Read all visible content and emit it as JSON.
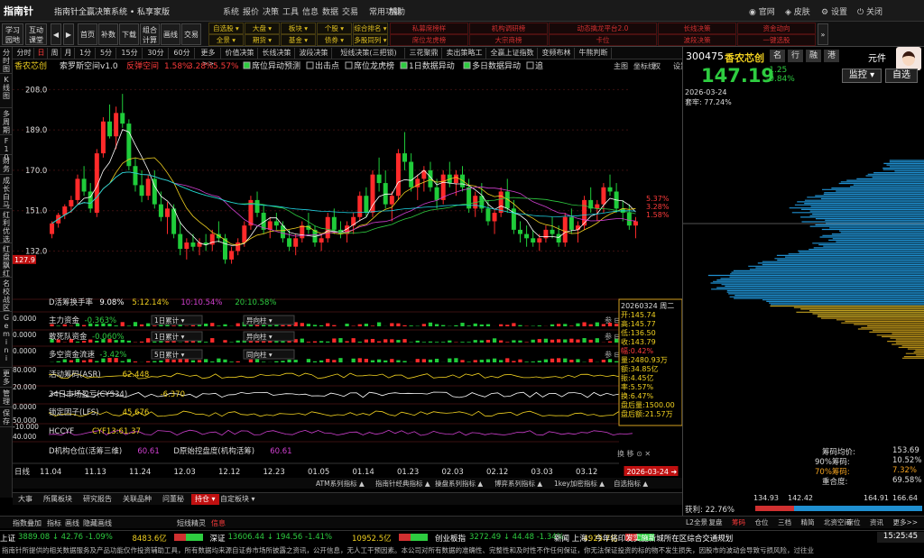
{
  "app": {
    "logo": "指南针",
    "title": "指南针全赢决策系统 • 私享家版",
    "menus": [
      "系统",
      "报价",
      "决策",
      "工具",
      "信息",
      "数据",
      "交易",
      "常用功能",
      "帮助"
    ],
    "win": [
      "官网",
      "皮肤",
      "设置",
      "关闭"
    ]
  },
  "toolbar": {
    "left": [
      {
        "a": "学习",
        "b": "园地"
      },
      {
        "a": "互动",
        "b": "课堂"
      }
    ],
    "nav": [
      "首页",
      "补数",
      "下载",
      "组合",
      "画线",
      "交易"
    ],
    "nav_sub": {
      "组合": "计算"
    },
    "grid_yellow": [
      [
        "自选股",
        "大盘",
        "板块",
        "个股",
        "综合排名"
      ],
      [
        "全景",
        "期货",
        "基金",
        "债券",
        "多股同列"
      ]
    ],
    "grid_red": [
      [
        "私募席榜样",
        "机构调研榜",
        "动态擒龙平台2.0",
        "长线决策",
        "资金动向"
      ],
      [
        "席位龙虎榜",
        "大宗商榜",
        "卡位",
        "波段决策",
        "一键选股"
      ]
    ]
  },
  "lefttabs": [
    "分时图",
    "K线图",
    "多周期",
    "F10",
    "财务",
    "成长白马",
    "红利优选",
    "红盘飘红",
    "名校战区",
    "Gemini",
    "更多",
    "管理",
    "保存"
  ],
  "periods": [
    "分时",
    "日",
    "周",
    "月",
    "1分",
    "5分",
    "15分",
    "30分",
    "60分",
    "更多>>"
  ],
  "strategies": [
    "价值决策",
    "长线决策",
    "波段决策",
    "短线决策(三把锁)",
    "三花聚鼎",
    "卖出策略工",
    "全赢上证指数",
    "变频布林",
    "牛熊判断"
  ],
  "stock": {
    "name": "香农芯创",
    "formula": "索罗斯空间v1.0",
    "extra": "反弹空间",
    "p1": "1.58%",
    "p2": "3.28%",
    "p3": "5.57%",
    "checks": [
      "席位异动预测",
      "出击点",
      "席位龙虎榜",
      "1日数据异动",
      "多日数据异动",
      "追"
    ],
    "tools": [
      "主图",
      "坐标线",
      "权",
      "设置"
    ]
  },
  "chart_data": {
    "type": "candlestick",
    "y_ticks": [
      208.0,
      189.0,
      170.0,
      151.0,
      132.0
    ],
    "current_price_label": "127.9",
    "x_ticks": [
      "11.04",
      "11.13",
      "11.24",
      "12.03",
      "12.12",
      "12.23",
      "01.05",
      "01.14",
      "01.23",
      "02.03",
      "02.12",
      "03.03",
      "03.12",
      "2026-03-24"
    ],
    "x_prefix": "日线",
    "right_labels": [
      "5.37%",
      "3.28%",
      "1.58%"
    ],
    "candles": [
      [
        140,
        146,
        138,
        145
      ],
      [
        145,
        150,
        143,
        149
      ],
      [
        149,
        154,
        147,
        153
      ],
      [
        153,
        158,
        150,
        156
      ],
      [
        156,
        168,
        154,
        166
      ],
      [
        166,
        172,
        158,
        160
      ],
      [
        160,
        164,
        150,
        152
      ],
      [
        150,
        180,
        148,
        178
      ],
      [
        178,
        195,
        176,
        193
      ],
      [
        193,
        201,
        185,
        186
      ],
      [
        186,
        200,
        180,
        197
      ],
      [
        197,
        206,
        190,
        192
      ],
      [
        192,
        194,
        170,
        172
      ],
      [
        172,
        176,
        160,
        163
      ],
      [
        163,
        170,
        155,
        158
      ],
      [
        158,
        168,
        156,
        166
      ],
      [
        166,
        170,
        152,
        154
      ],
      [
        154,
        160,
        146,
        148
      ],
      [
        148,
        155,
        140,
        152
      ],
      [
        152,
        154,
        138,
        140
      ],
      [
        140,
        146,
        130,
        133
      ],
      [
        133,
        138,
        128,
        136
      ],
      [
        136,
        140,
        132,
        134
      ],
      [
        134,
        138,
        130,
        136
      ],
      [
        136,
        140,
        132,
        135
      ],
      [
        135,
        142,
        132,
        140
      ],
      [
        140,
        146,
        136,
        138
      ],
      [
        138,
        140,
        126,
        128
      ],
      [
        128,
        134,
        126,
        132
      ],
      [
        132,
        138,
        130,
        136
      ],
      [
        136,
        146,
        134,
        144
      ],
      [
        144,
        158,
        142,
        156
      ],
      [
        156,
        160,
        148,
        150
      ],
      [
        150,
        154,
        140,
        142
      ],
      [
        142,
        148,
        138,
        146
      ],
      [
        146,
        150,
        142,
        144
      ],
      [
        144,
        146,
        136,
        138
      ],
      [
        138,
        142,
        132,
        134
      ],
      [
        134,
        140,
        130,
        138
      ],
      [
        138,
        146,
        136,
        144
      ],
      [
        144,
        150,
        140,
        142
      ],
      [
        142,
        144,
        134,
        136
      ],
      [
        136,
        140,
        132,
        138
      ],
      [
        138,
        150,
        136,
        148
      ],
      [
        148,
        152,
        140,
        142
      ],
      [
        142,
        146,
        138,
        140
      ],
      [
        140,
        146,
        136,
        144
      ],
      [
        144,
        150,
        140,
        148
      ],
      [
        148,
        160,
        146,
        158
      ],
      [
        158,
        162,
        148,
        150
      ],
      [
        150,
        170,
        148,
        168
      ],
      [
        168,
        176,
        160,
        164
      ],
      [
        164,
        170,
        152,
        154
      ],
      [
        154,
        160,
        146,
        158
      ],
      [
        158,
        180,
        156,
        178
      ],
      [
        178,
        188,
        170,
        174
      ],
      [
        174,
        178,
        160,
        162
      ],
      [
        162,
        168,
        156,
        166
      ],
      [
        166,
        172,
        160,
        170
      ],
      [
        170,
        174,
        160,
        162
      ],
      [
        162,
        166,
        152,
        156
      ],
      [
        156,
        170,
        154,
        168
      ],
      [
        168,
        174,
        162,
        164
      ],
      [
        164,
        170,
        158,
        168
      ],
      [
        168,
        172,
        160,
        162
      ],
      [
        162,
        166,
        150,
        152
      ],
      [
        152,
        160,
        148,
        158
      ],
      [
        158,
        164,
        150,
        152
      ],
      [
        152,
        156,
        144,
        146
      ],
      [
        146,
        152,
        140,
        150
      ],
      [
        150,
        162,
        148,
        160
      ],
      [
        160,
        166,
        150,
        152
      ],
      [
        152,
        156,
        140,
        142
      ],
      [
        142,
        146,
        136,
        140
      ],
      [
        140,
        144,
        134,
        138
      ],
      [
        138,
        142,
        134,
        136
      ],
      [
        136,
        140,
        132,
        138
      ],
      [
        138,
        144,
        136,
        142
      ],
      [
        142,
        148,
        138,
        140
      ],
      [
        140,
        144,
        134,
        136
      ],
      [
        136,
        150,
        134,
        148
      ],
      [
        148,
        152,
        140,
        142
      ],
      [
        142,
        146,
        136,
        144
      ],
      [
        144,
        158,
        142,
        156
      ],
      [
        156,
        162,
        150,
        152
      ],
      [
        152,
        156,
        146,
        154
      ],
      [
        154,
        164,
        150,
        162
      ],
      [
        162,
        168,
        158,
        160
      ],
      [
        160,
        164,
        150,
        152
      ],
      [
        152,
        156,
        146,
        150
      ],
      [
        150,
        154,
        142,
        144
      ],
      [
        144,
        148,
        138,
        146
      ]
    ]
  },
  "indicators": [
    {
      "name": "D活筹换手率",
      "vals": [
        "9.08%",
        "5:12.14%",
        "10:10.54%",
        "20:10.58%"
      ]
    },
    {
      "name": "主力资金",
      "val": "-0.363%",
      "sel": "1日累计",
      "sel2": "异向柱"
    },
    {
      "name": "敢死队资金",
      "val": "-0.060%",
      "sel": "1日累计",
      "sel2": "异向柱"
    },
    {
      "name": "多空资金流速",
      "val": "-3.42%",
      "sel": "5日累计",
      "sel2": "同向柱"
    },
    {
      "name": "活动筹码(ASR)",
      "val": "62.448"
    },
    {
      "name": "34日市场盈亏(CYS34)",
      "val": "-6.370"
    },
    {
      "name": "锁定因子(LFS)",
      "val": "45.676"
    },
    {
      "name": "HCCYF",
      "val": "CYF13:61.37"
    },
    {
      "name": "D机构仓位(活筹三维)",
      "val": "60.61",
      "name2": "D原始控盘度(机构活筹)",
      "val2": "60.61"
    }
  ],
  "ind_axis": {
    "a": "0.0000",
    "b": "0.0000",
    "c": "0.0000",
    "d": "80.000",
    "e": "20.000",
    "f": "0.0000",
    "g": "50.000",
    "h": "-10.000",
    "i": "40.000"
  },
  "ohlc_box": {
    "date": "20260324 周二",
    "rows": [
      [
        "开",
        "145.74"
      ],
      [
        "高",
        "145.77"
      ],
      [
        "低",
        "136.50"
      ],
      [
        "收",
        "143.79"
      ],
      [
        "幅",
        "0.42%"
      ],
      [
        "量",
        "2480.93万"
      ],
      [
        "额",
        "34.85亿"
      ],
      [
        "振",
        "4.45亿"
      ],
      [
        "率",
        "5.57%"
      ],
      [
        "换",
        "6.47%"
      ],
      [
        "盘后量",
        "1500.00"
      ],
      [
        "盘后额",
        "21.57万"
      ]
    ]
  },
  "quote": {
    "code": "300475",
    "name": "香农芯创",
    "tags": [
      "名",
      "行",
      "融",
      "港"
    ],
    "unit": "元件",
    "price": "147.19",
    "chg": "-1.25",
    "pct": "-0.84%",
    "btn_monitor": "监控",
    "btn_self": "自选",
    "date": "2026-03-24",
    "cost": "套牢: 77.24%"
  },
  "chip": {
    "avg": [
      "筹码均价:",
      "153.69"
    ],
    "p90": [
      "90%筹码:",
      "10.52%"
    ],
    "p70": [
      "70%筹码:",
      "7.32%"
    ],
    "overlap": [
      "重合度:",
      "69.58%"
    ],
    "profit": "获利: 22.76%",
    "ticks": [
      "134.93",
      "142.42",
      "164.91",
      "166.64"
    ]
  },
  "right_tabs": [
    "L2全景",
    "复盘",
    "筹码",
    "仓位",
    "三档",
    "精简",
    "北资空间",
    "席位",
    "资讯",
    "更多>>"
  ],
  "bottom_tabs": [
    "大事",
    "所属板块",
    "研究报告",
    "关联品种",
    "问董秘",
    "持仓",
    "自定板块"
  ],
  "bottom_menu": [
    "ATM系列指标",
    "指南针经典指标",
    "操盘系列指标",
    "博弈系列指标",
    "1key加密指标",
    "自选指标"
  ],
  "hint": {
    "a": "指数叠加",
    "b": "指标",
    "c": "画线",
    "d": "隐藏画线",
    "e": "短线精灵",
    "f": "信息",
    "input": "请输入命令或股票",
    "time": "15:25:45"
  },
  "ticker": [
    {
      "label": "上证",
      "val": "3889.08",
      "chg": "42.76",
      "pct": "-1.09%",
      "amt": "8483.6亿"
    },
    {
      "label": "深证",
      "val": "13606.44",
      "chg": "194.56",
      "pct": "-1.41%",
      "amt": "10952.5亿"
    },
    {
      "label": "创业板指",
      "val": "3272.49",
      "chg": "44.48",
      "pct": "-1.34%",
      "amt": "4925.7亿"
    }
  ],
  "news": "新闻 上海：今年将印发实施新城所在区综合交通规划",
  "disclaimer": "指南针所提供的相关数据服务及产品功能仅作投资辅助工具，所有数据均来源自证券市场所披露之资讯，公开信息，无人工干预因素。本公司对所有数据的准确性、完整性和及时性不作任何保证，你无法保证投资的标的物不发生损失，因股市的波动会导致亏损风险，过往业"
}
